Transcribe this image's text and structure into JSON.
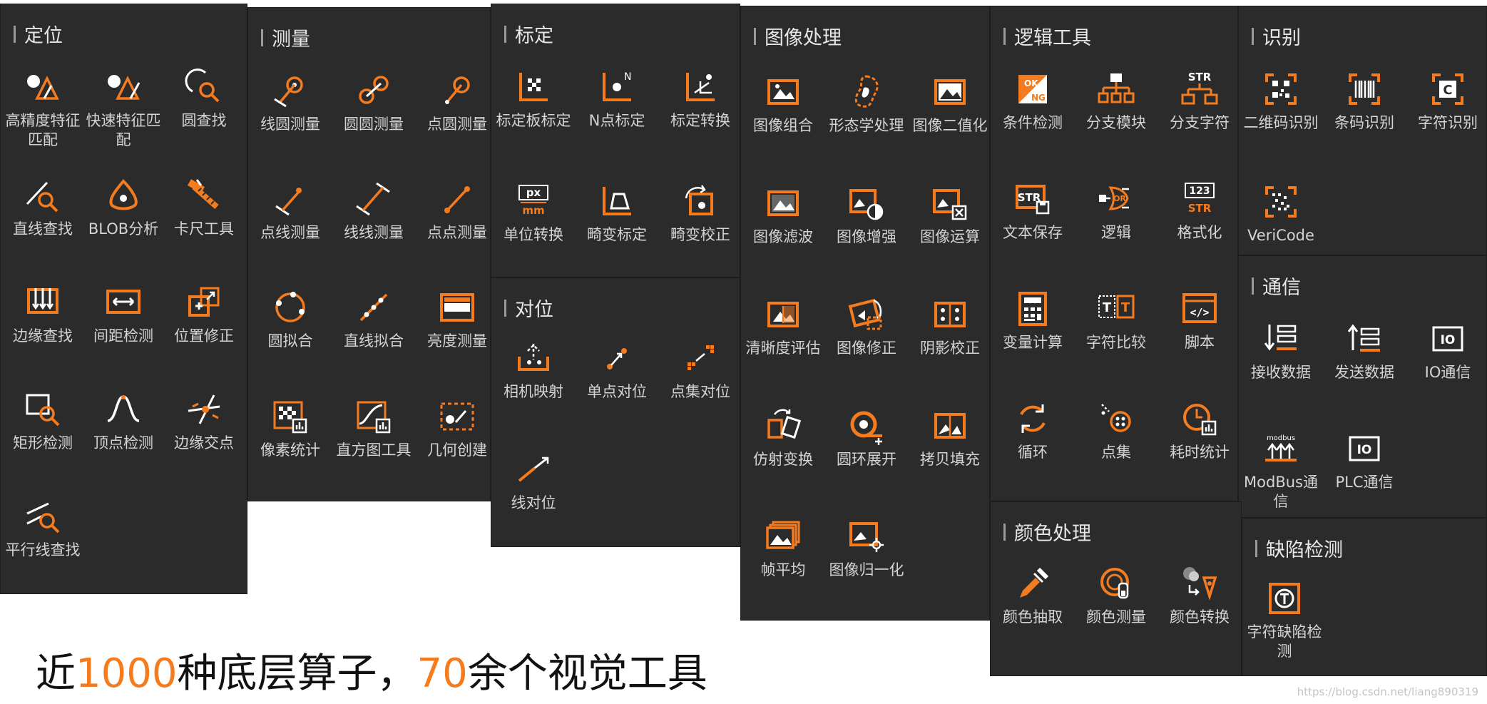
{
  "accent_color": "#f57b1f",
  "panel_color": "#2b2b2b",
  "panels": {
    "dingwei": {
      "title": "定位",
      "tools": [
        {
          "label": "高精度特征匹配",
          "icon": "precision-feature-match-icon"
        },
        {
          "label": "快速特征匹配",
          "icon": "fast-feature-match-icon"
        },
        {
          "label": "圆查找",
          "icon": "circle-find-icon"
        },
        {
          "label": "直线查找",
          "icon": "line-find-icon"
        },
        {
          "label": "BLOB分析",
          "icon": "blob-analysis-icon"
        },
        {
          "label": "卡尺工具",
          "icon": "caliper-icon"
        },
        {
          "label": "边缘查找",
          "icon": "edge-find-icon"
        },
        {
          "label": "间距检测",
          "icon": "spacing-detect-icon"
        },
        {
          "label": "位置修正",
          "icon": "position-correct-icon"
        },
        {
          "label": "矩形检测",
          "icon": "rectangle-detect-icon"
        },
        {
          "label": "顶点检测",
          "icon": "vertex-detect-icon"
        },
        {
          "label": "边缘交点",
          "icon": "edge-intersection-icon"
        },
        {
          "label": "平行线查找",
          "icon": "parallel-line-find-icon"
        }
      ]
    },
    "celiang": {
      "title": "测量",
      "tools": [
        {
          "label": "线圆测量",
          "icon": "line-circle-measure-icon"
        },
        {
          "label": "圆圆测量",
          "icon": "circle-circle-measure-icon"
        },
        {
          "label": "点圆测量",
          "icon": "point-circle-measure-icon"
        },
        {
          "label": "点线测量",
          "icon": "point-line-measure-icon"
        },
        {
          "label": "线线测量",
          "icon": "line-line-measure-icon"
        },
        {
          "label": "点点测量",
          "icon": "point-point-measure-icon"
        },
        {
          "label": "圆拟合",
          "icon": "circle-fit-icon"
        },
        {
          "label": "直线拟合",
          "icon": "line-fit-icon"
        },
        {
          "label": "亮度测量",
          "icon": "brightness-measure-icon"
        },
        {
          "label": "像素统计",
          "icon": "pixel-stats-icon"
        },
        {
          "label": "直方图工具",
          "icon": "histogram-icon"
        },
        {
          "label": "几何创建",
          "icon": "geometry-create-icon"
        }
      ]
    },
    "biaoding": {
      "title": "标定",
      "tools": [
        {
          "label": "标定板标定",
          "icon": "calib-board-icon"
        },
        {
          "label": "N点标定",
          "icon": "n-point-calib-icon"
        },
        {
          "label": "标定转换",
          "icon": "calib-convert-icon"
        },
        {
          "label": "单位转换",
          "icon": "unit-convert-icon",
          "glyph_top": "px",
          "glyph_bottom": "mm"
        },
        {
          "label": "畸变标定",
          "icon": "distortion-calib-icon"
        },
        {
          "label": "畸变校正",
          "icon": "distortion-correct-icon"
        }
      ]
    },
    "duiwei": {
      "title": "对位",
      "tools": [
        {
          "label": "相机映射",
          "icon": "camera-map-icon"
        },
        {
          "label": "单点对位",
          "icon": "single-point-align-icon"
        },
        {
          "label": "点集对位",
          "icon": "point-set-align-icon"
        },
        {
          "label": "线对位",
          "icon": "line-align-icon"
        }
      ]
    },
    "tuxiang": {
      "title": "图像处理",
      "tools": [
        {
          "label": "图像组合",
          "icon": "image-combine-icon"
        },
        {
          "label": "形态学处理",
          "icon": "morphology-icon"
        },
        {
          "label": "图像二值化",
          "icon": "binarize-icon"
        },
        {
          "label": "图像滤波",
          "icon": "image-filter-icon"
        },
        {
          "label": "图像增强",
          "icon": "image-enhance-icon"
        },
        {
          "label": "图像运算",
          "icon": "image-arith-icon"
        },
        {
          "label": "清晰度评估",
          "icon": "sharpness-icon"
        },
        {
          "label": "图像修正",
          "icon": "image-fix-icon"
        },
        {
          "label": "阴影校正",
          "icon": "shadow-correct-icon"
        },
        {
          "label": "仿射变换",
          "icon": "affine-icon"
        },
        {
          "label": "圆环展开",
          "icon": "ring-unwrap-icon"
        },
        {
          "label": "拷贝填充",
          "icon": "copy-fill-icon"
        },
        {
          "label": "帧平均",
          "icon": "frame-average-icon"
        },
        {
          "label": "图像归一化",
          "icon": "normalize-icon"
        }
      ]
    },
    "luoji": {
      "title": "逻辑工具",
      "tools": [
        {
          "label": "条件检测",
          "icon": "condition-detect-icon",
          "glyph_top": "OK",
          "glyph_bottom": "NG"
        },
        {
          "label": "分支模块",
          "icon": "branch-module-icon"
        },
        {
          "label": "分支字符",
          "icon": "branch-string-icon",
          "glyph_top": "STR"
        },
        {
          "label": "文本保存",
          "icon": "text-save-icon",
          "glyph_top": "STR"
        },
        {
          "label": "逻辑",
          "icon": "logic-icon",
          "glyph_top": "OR"
        },
        {
          "label": "格式化",
          "icon": "format-icon",
          "glyph_top": "123",
          "glyph_bottom": "STR"
        },
        {
          "label": "变量计算",
          "icon": "variable-calc-icon"
        },
        {
          "label": "字符比较",
          "icon": "string-compare-icon",
          "glyph_top": "T",
          "glyph_bottom": "T"
        },
        {
          "label": "脚本",
          "icon": "script-icon",
          "glyph_top": "</>"
        },
        {
          "label": "循环",
          "icon": "loop-icon"
        },
        {
          "label": "点集",
          "icon": "point-set-icon"
        },
        {
          "label": "耗时统计",
          "icon": "time-stats-icon"
        }
      ]
    },
    "shibie": {
      "title": "识别",
      "tools": [
        {
          "label": "二维码识别",
          "icon": "qrcode-icon"
        },
        {
          "label": "条码识别",
          "icon": "barcode-icon"
        },
        {
          "label": "字符识别",
          "icon": "ocr-icon",
          "glyph_top": "C"
        },
        {
          "label": "VeriCode",
          "icon": "vericode-icon"
        }
      ]
    },
    "tongxin": {
      "title": "通信",
      "tools": [
        {
          "label": "接收数据",
          "icon": "receive-data-icon"
        },
        {
          "label": "发送数据",
          "icon": "send-data-icon"
        },
        {
          "label": "IO通信",
          "icon": "io-comm-icon",
          "glyph_top": "IO"
        },
        {
          "label": "ModBus通信",
          "icon": "modbus-icon",
          "glyph_top": "modbus"
        },
        {
          "label": "PLC通信",
          "icon": "plc-comm-icon",
          "glyph_top": "IO"
        }
      ]
    },
    "yanse": {
      "title": "颜色处理",
      "tools": [
        {
          "label": "颜色抽取",
          "icon": "color-extract-icon"
        },
        {
          "label": "颜色测量",
          "icon": "color-measure-icon"
        },
        {
          "label": "颜色转换",
          "icon": "color-convert-icon"
        }
      ]
    },
    "quexian": {
      "title": "缺陷检测",
      "tools": [
        {
          "label": "字符缺陷检测",
          "icon": "char-defect-icon"
        }
      ]
    }
  },
  "tagline": {
    "part1": "近",
    "num1": "1000",
    "part2": "种底层算子，",
    "num2": "70",
    "part3": "余个视觉工具"
  },
  "watermark": "https://blog.csdn.net/liang890319"
}
